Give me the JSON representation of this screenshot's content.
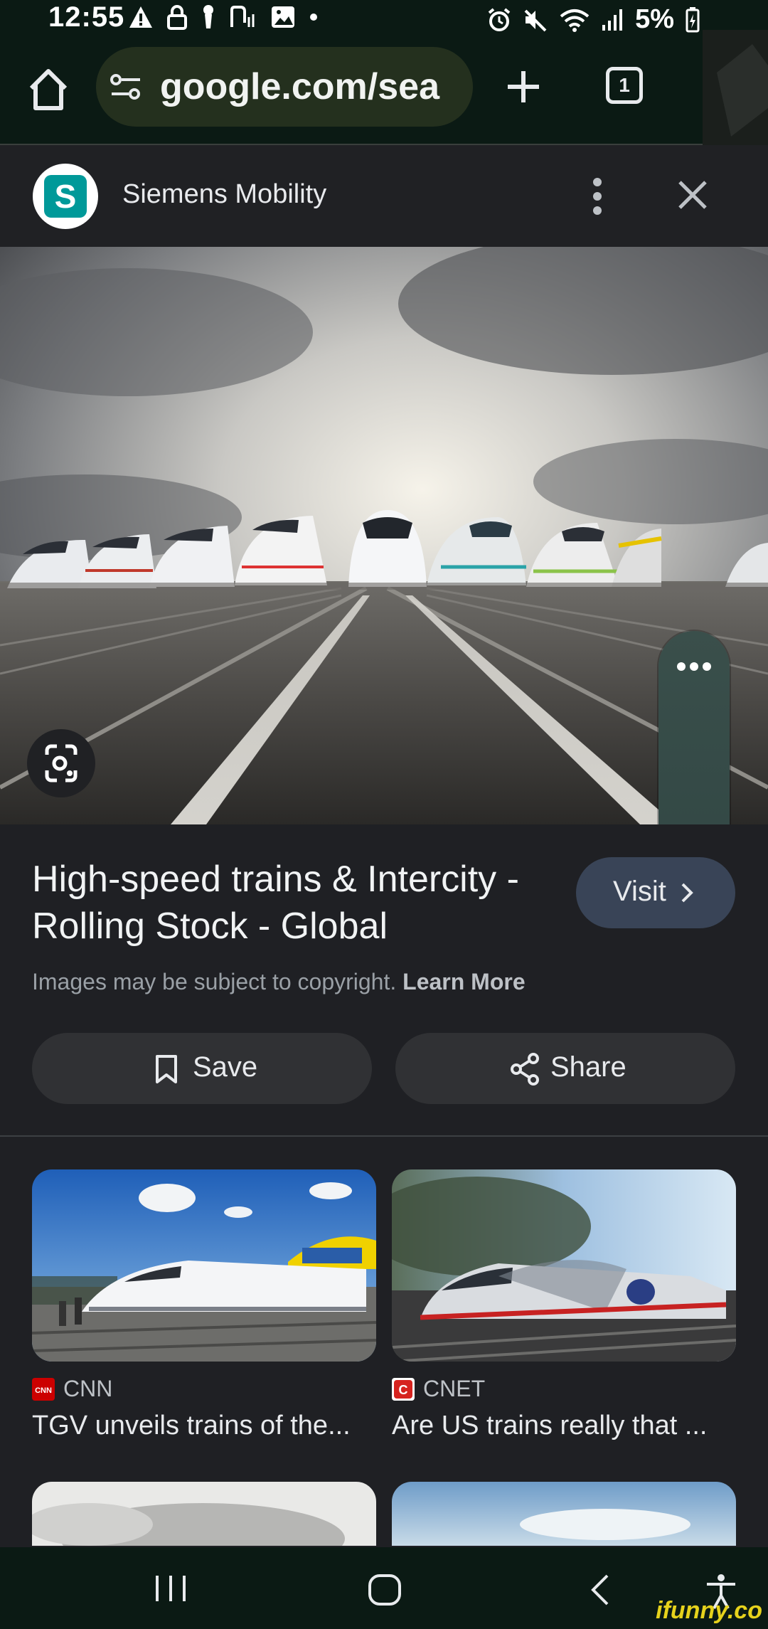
{
  "status_bar": {
    "time": "12:55",
    "battery": "5%"
  },
  "browser": {
    "url": "google.com/sea",
    "tab_count": "1"
  },
  "source": {
    "logo_letter": "S",
    "name": "Siemens Mobility"
  },
  "media_volume": {
    "level": 0.27
  },
  "result": {
    "title": "High-speed trains & Intercity - Rolling Stock - Global",
    "visit_label": "Visit",
    "copyright_text": "Images may be subject to copyright.",
    "learn_more": "Learn More",
    "save_label": "Save",
    "share_label": "Share"
  },
  "related": [
    {
      "source": "CNN",
      "favicon_text": "CNN",
      "title": "TGV unveils trains of the...",
      "favicon_color": "#cc0000"
    },
    {
      "source": "CNET",
      "favicon_text": "C",
      "title": "Are US trains really that ...",
      "favicon_color": "#d6231f"
    }
  ],
  "watermark": "ifunny.co",
  "icons": [
    "home-icon",
    "tune-icon",
    "plus-icon",
    "tab-switcher-icon",
    "more-vert-icon",
    "close-icon",
    "lens-icon",
    "bookmark-icon",
    "share-icon",
    "chevron-right-icon",
    "recents-icon",
    "home-nav-icon",
    "back-icon",
    "accessibility-icon"
  ]
}
